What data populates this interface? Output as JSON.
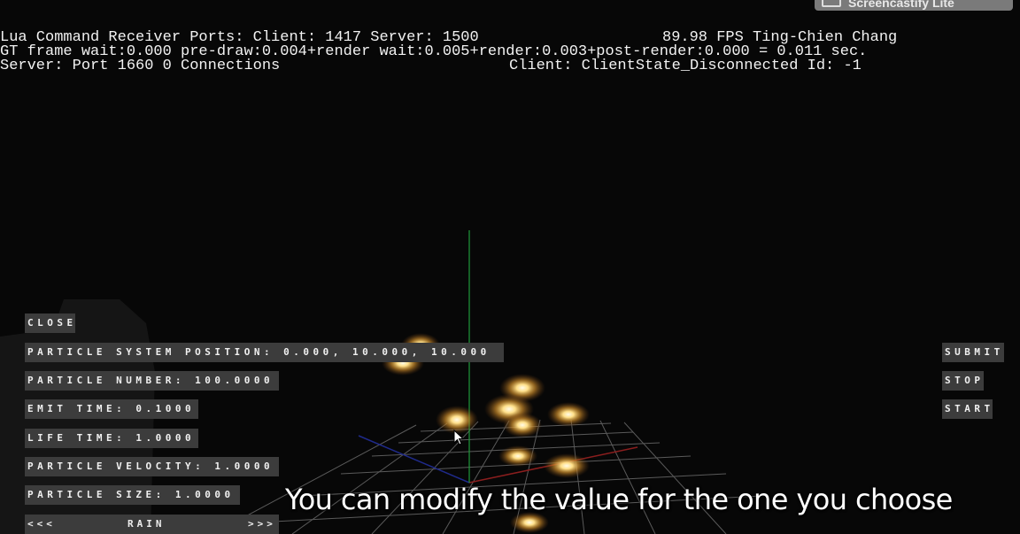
{
  "hud": {
    "line1": "Lua Command Receiver Ports: Client: 1417 Server: 1500",
    "fps": "89.98 FPS Ting-Chien Chang",
    "line2": "GT frame wait:0.000 pre-draw:0.004+render wait:0.005+render:0.003+post-render:0.000 = 0.011 sec.",
    "line3_left": "Server: Port 1660 0 Connections",
    "line3_right": "Client: ClientState_Disconnected Id: -1"
  },
  "watermark": {
    "text": "Screencastify Lite"
  },
  "panel": {
    "close": "CLOSE",
    "position": "PARTICLE SYSTEM POSITION: 0.000, 10.000, 10.000",
    "number": "PARTICLE NUMBER: 100.0000",
    "emit_time": "EMIT TIME: 0.1000",
    "life_time": "LIFE TIME: 1.0000",
    "velocity": "PARTICLE VELOCITY: 1.0000",
    "size": "PARTICLE SIZE: 1.0000",
    "nav_prev": "<<<",
    "nav_label": "RAIN",
    "nav_next": ">>>"
  },
  "actions": {
    "submit": "SUBMIT",
    "stop": "STOP",
    "start": "START"
  },
  "caption": "You can modify the value for the one you choose"
}
